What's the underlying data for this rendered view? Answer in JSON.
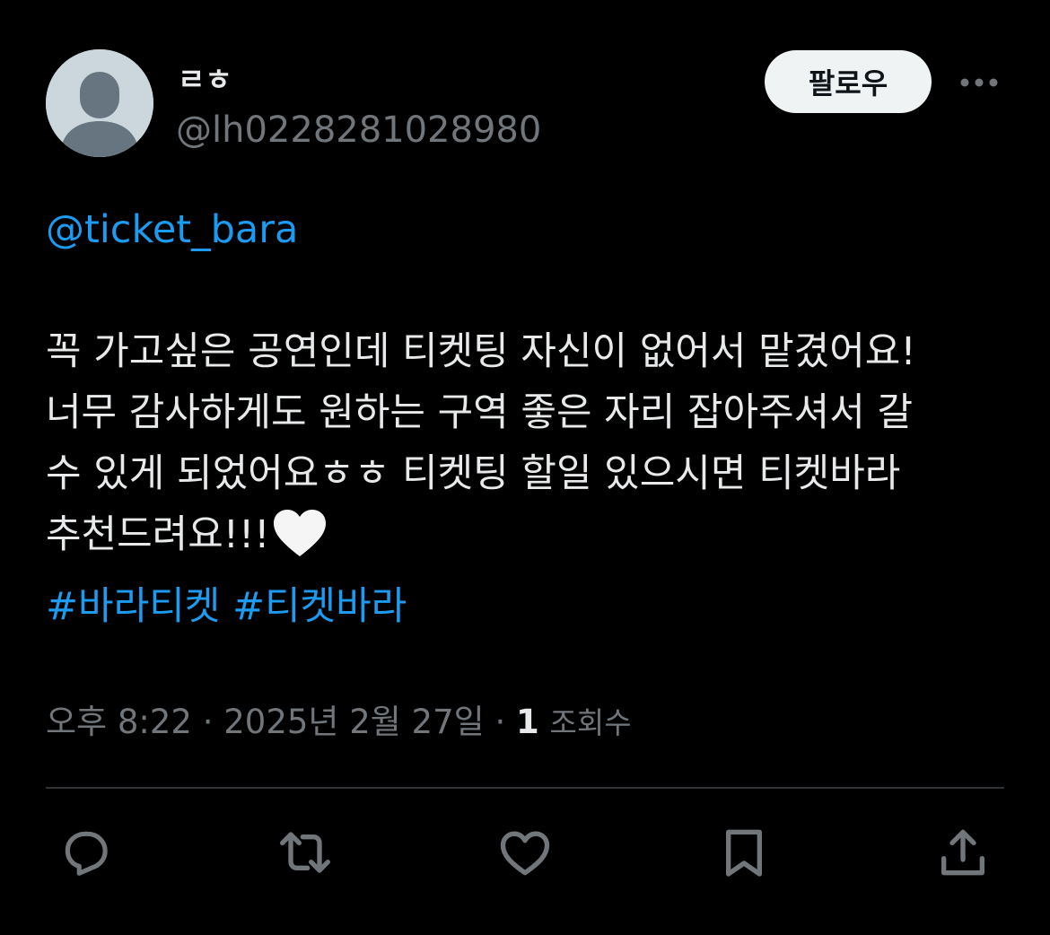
{
  "author": {
    "display_name": "ㄹㅎ",
    "handle": "@lh0228281028980",
    "avatar_icon": "default-avatar-icon"
  },
  "header": {
    "follow_label": "팔로우",
    "more_icon": "more-horizontal-icon"
  },
  "tweet": {
    "mention": "@ticket_bara",
    "lines": [
      "꼭 가고싶은 공연인데 티켓팅 자신이 없어서 맡겼어요!",
      "너무 감사하게도 원하는 구역 좋은 자리 잡아주셔서 갈",
      "수 있게 되었어요ㅎㅎ 티켓팅 할일 있으시면 티켓바라",
      "추천드려요!!!"
    ],
    "emoji": "white-heart-icon",
    "hashtags": [
      "#바라티켓",
      "#티켓바라"
    ]
  },
  "meta": {
    "time": "오후 8:22",
    "separator": "·",
    "date": "2025년 2월 27일",
    "views_count": "1",
    "views_label": "조회수"
  },
  "actions": [
    {
      "name": "reply-icon"
    },
    {
      "name": "retweet-icon"
    },
    {
      "name": "like-icon"
    },
    {
      "name": "bookmark-icon"
    },
    {
      "name": "share-icon"
    }
  ],
  "colors": {
    "background": "#000000",
    "text": "#e7e9ea",
    "secondary": "#71767b",
    "accent": "#1d9bf0",
    "divider": "#2f3336"
  }
}
